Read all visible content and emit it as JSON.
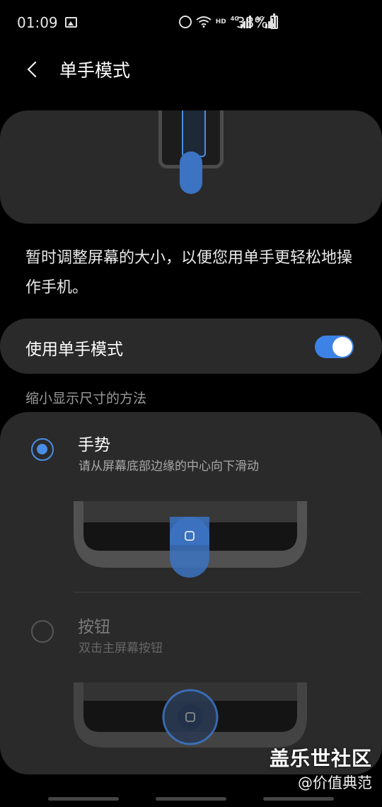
{
  "status_bar": {
    "time": "01:09",
    "network_hd": "HD",
    "network_4g_1": "4G",
    "network_4g_2": "4G",
    "battery": "33%"
  },
  "header": {
    "title": "单手模式"
  },
  "description": "暂时调整屏幕的大小，以便您用单手更轻松地操作手机。",
  "toggle": {
    "label": "使用单手模式",
    "on": true
  },
  "section_header": "缩小显示尺寸的方法",
  "methods": [
    {
      "title": "手势",
      "subtitle": "请从屏幕底部边缘的中心向下滑动",
      "selected": true
    },
    {
      "title": "按钮",
      "subtitle": "双击主屏幕按钮",
      "selected": false
    }
  ],
  "watermark": {
    "title": "盖乐世社区",
    "subtitle": "@价值典范"
  },
  "colors": {
    "accent": "#3d82e6",
    "card": "#2a2a2a",
    "background": "#000000"
  }
}
